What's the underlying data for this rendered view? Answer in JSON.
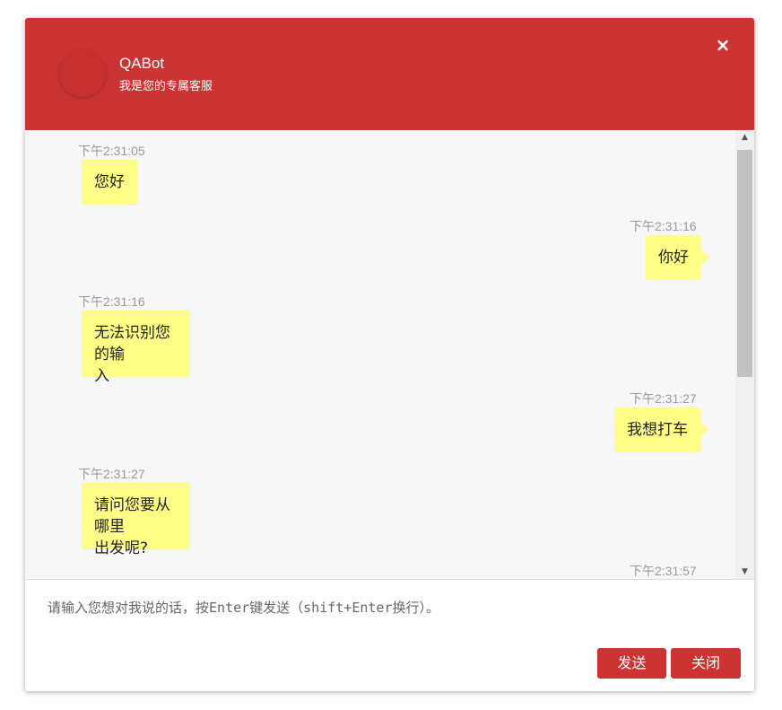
{
  "header": {
    "bot_name": "QABot",
    "subtitle": "我是您的专属客服",
    "close_glyph": "×",
    "accent_color": "#cc3333"
  },
  "messages": [
    {
      "side": "left",
      "time": "下午2:31:05",
      "text": "您好"
    },
    {
      "side": "right",
      "time": "下午2:31:16",
      "text": "你好"
    },
    {
      "side": "left",
      "time": "下午2:31:16",
      "line1": "无法识别您的输",
      "line2": "入"
    },
    {
      "side": "right",
      "time": "下午2:31:27",
      "text": "我想打车"
    },
    {
      "side": "left",
      "time": "下午2:31:27",
      "line1": "请问您要从哪里",
      "line2": "出发呢?"
    },
    {
      "side": "right",
      "time": "下午2:31:57"
    }
  ],
  "input": {
    "placeholder": "请输入您想对我说的话，按Enter键发送（shift+Enter换行）。"
  },
  "buttons": {
    "send": "发送",
    "close": "关闭"
  },
  "bubble_color": "#ffff88"
}
